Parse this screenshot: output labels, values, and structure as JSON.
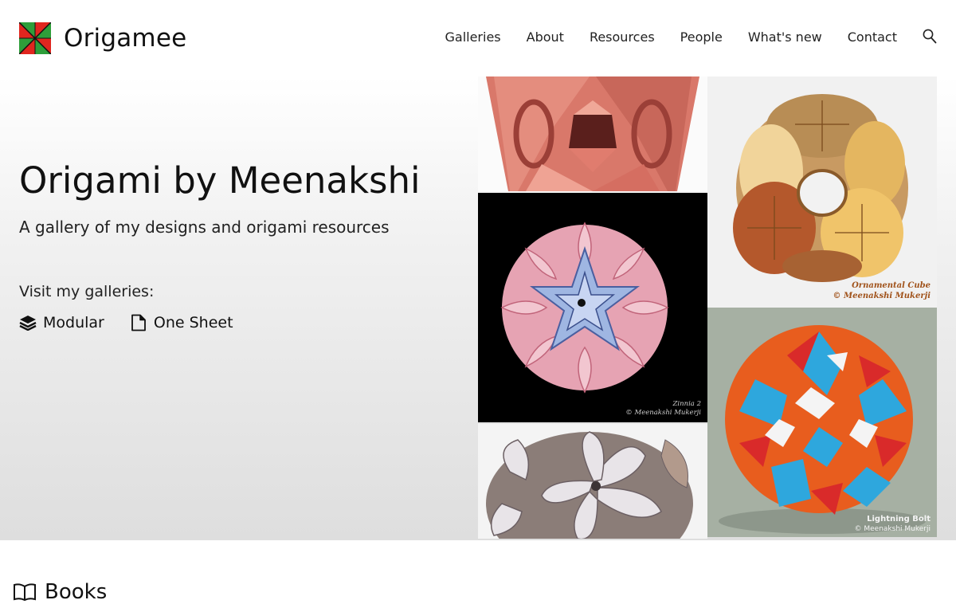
{
  "brand": {
    "name": "Origamee",
    "logo_icon": "pinwheel-logo-icon"
  },
  "nav": {
    "items": [
      {
        "label": "Galleries"
      },
      {
        "label": "About"
      },
      {
        "label": "Resources"
      },
      {
        "label": "People"
      },
      {
        "label": "What's new"
      },
      {
        "label": "Contact"
      }
    ],
    "search_icon": "search-icon"
  },
  "hero": {
    "title": "Origami by Meenakshi",
    "subtitle": "A gallery of my designs and origami resources",
    "visit_label": "Visit my galleries:",
    "links": [
      {
        "label": "Modular",
        "icon": "layers-icon"
      },
      {
        "label": "One Sheet",
        "icon": "page-icon"
      }
    ]
  },
  "gallery": {
    "tiles": [
      {
        "name": "pink-modular-photo",
        "caption": []
      },
      {
        "name": "zinnia-photo",
        "caption": [
          "Zinnia 2",
          "© Meenakshi Mukerji"
        ]
      },
      {
        "name": "floral-ball-photo",
        "caption": []
      },
      {
        "name": "ornamental-cube-photo",
        "caption": [
          "Ornamental Cube",
          "© Meenakshi Mukerji"
        ]
      },
      {
        "name": "lightning-bolt-photo",
        "caption": [
          "Lightning Bolt",
          "© Meenakshi Mukerji"
        ]
      }
    ]
  },
  "section": {
    "heading": "Books",
    "icon": "book-icon"
  },
  "colors": {
    "text": "#111111",
    "hero_top": "#ffffff",
    "hero_bottom": "#dedede",
    "logo_red": "#e0261f",
    "logo_green": "#2e9e3a",
    "logo_yellow": "#f6d20a"
  }
}
